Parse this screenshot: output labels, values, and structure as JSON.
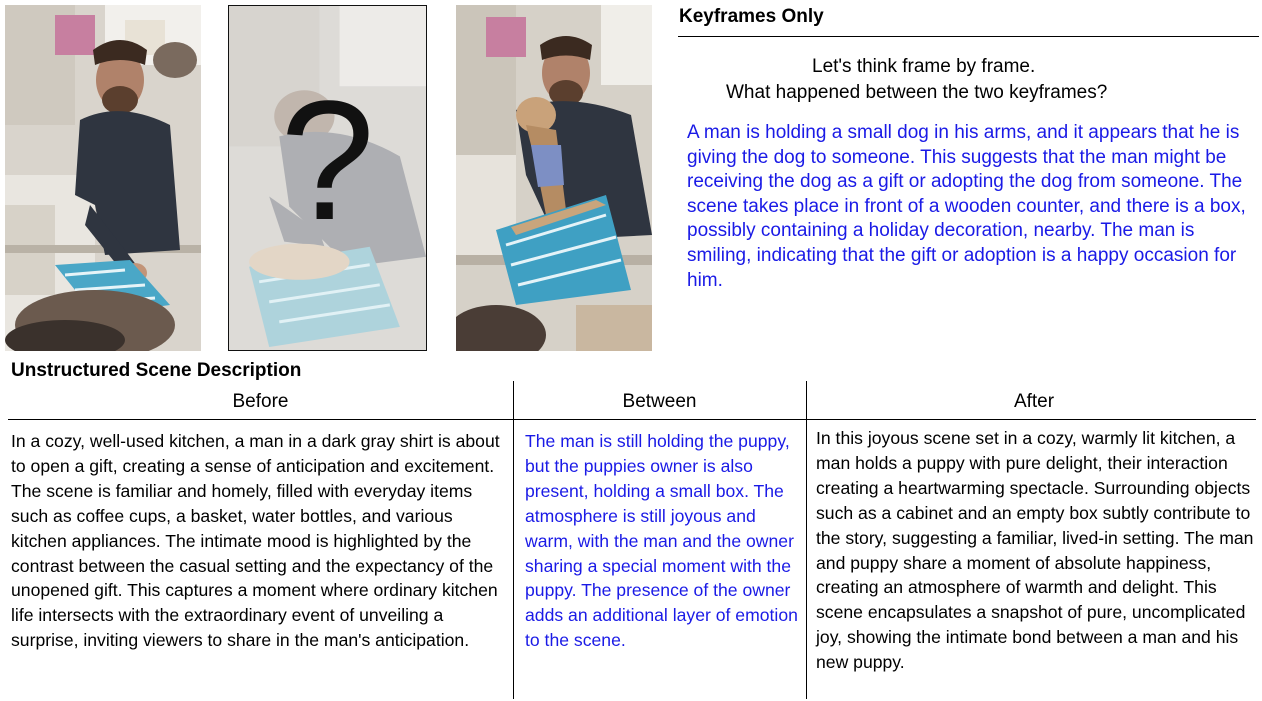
{
  "frames": {
    "first_alt": "first keyframe photo",
    "middle_symbol": "?",
    "last_alt": "last keyframe photo"
  },
  "keyframes": {
    "title": "Keyframes Only",
    "prompt_line1": "Let's think frame by frame.",
    "prompt_line2": "What happened between the two keyframes?",
    "answer": "A man is holding a small dog in his arms, and it appears that he is giving the dog to someone. This suggests that the man might be receiving the dog as a gift or adopting the dog from someone. The scene takes place in front of a wooden counter, and there is a box, possibly containing a holiday decoration, nearby. The man is smiling, indicating that the gift or adoption is a happy occasion for him.",
    "answer_color": "#1a1ae6"
  },
  "scene": {
    "title": "Unstructured Scene Description",
    "columns": {
      "before": "Before",
      "between": "Between",
      "after": "After"
    },
    "before_text": "In a cozy, well-used kitchen, a man in a dark gray shirt is about to open a gift, creating a sense of anticipation and excitement. The scene is familiar and homely, filled with everyday items such as coffee cups, a basket, water bottles, and various kitchen appliances. The intimate mood is highlighted by the contrast between the casual setting and the expectancy of the unopened gift. This captures a moment where ordinary kitchen life intersects with the extraordinary event of unveiling a surprise, inviting viewers to share in the man's anticipation.",
    "between_text": "The man is still holding the puppy, but the puppies owner is also present, holding a small box. The atmosphere is still joyous and warm, with the man and the owner sharing a special moment with the puppy. The presence of the owner adds an additional layer of emotion to the scene.",
    "after_text": "In this joyous scene set in a cozy, warmly lit kitchen, a man holds a puppy with pure delight, their interaction creating a heartwarming spectacle. Surrounding objects such as a cabinet and an empty box subtly contribute to the story, suggesting a familiar, lived-in setting. The man and puppy share a moment of absolute happiness, creating an atmosphere of warmth and delight. This scene encapsulates a snapshot of pure, uncomplicated joy, showing the intimate bond between a man and his new puppy.",
    "between_color": "#1a1ae6"
  }
}
